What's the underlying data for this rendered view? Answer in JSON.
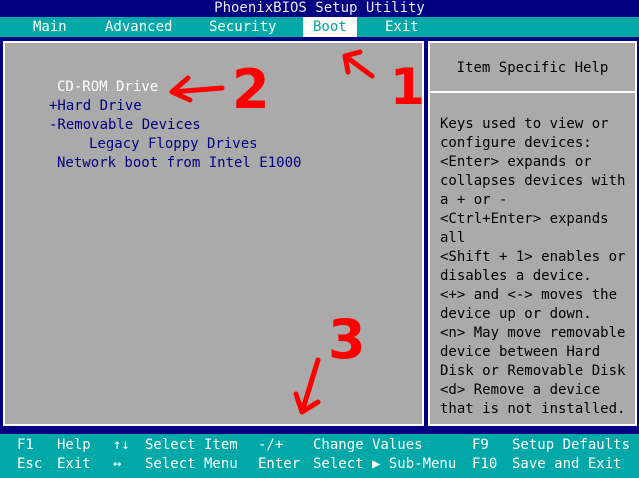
{
  "title": "PhoenixBIOS Setup Utility",
  "menu": [
    "Main",
    "Advanced",
    "Security",
    "Boot",
    "Exit"
  ],
  "active_menu": "Boot",
  "boot_items": [
    "CD-ROM Drive",
    "+Hard Drive",
    "-Removable Devices",
    "Legacy Floppy Drives",
    "Network boot from Intel E1000"
  ],
  "help": {
    "title": "Item Specific Help",
    "text": "Keys used to view or\nconfigure devices:\n<Enter> expands or\ncollapses devices with\na + or -\n<Ctrl+Enter> expands\nall\n<Shift + 1> enables or\ndisables a device.\n<+> and <-> moves the\ndevice up or down.\n<n> May move removable\ndevice between Hard\nDisk or Removable Disk\n<d> Remove a device\nthat is not installed."
  },
  "statusbar": {
    "row1": {
      "k1": "F1",
      "d1": "Help",
      "k2": "↑↓",
      "d2": "Select Item",
      "k3": "-/+",
      "d3": "Change Values",
      "k4": "F9",
      "d4": "Setup Defaults"
    },
    "row2": {
      "k1": "Esc",
      "d1": "Exit",
      "k2": "↔",
      "d2": "Select Menu",
      "k3": "Enter",
      "d3": "Select ▶ Sub-Menu",
      "k4": "F10",
      "d4": "Save and Exit"
    }
  },
  "annotations": [
    "1",
    "2",
    "3"
  ],
  "colors": {
    "bg": "#000080",
    "menubar": "#00a8a8",
    "panel": "#aaaaaa",
    "annotation": "#ff0000"
  }
}
